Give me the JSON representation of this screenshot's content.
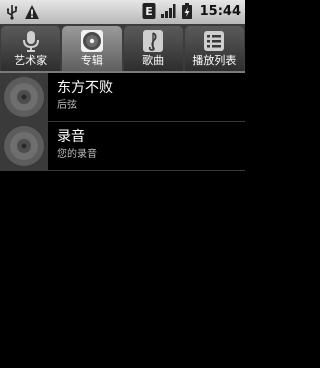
{
  "status_bar": {
    "time": "15:44",
    "icons": [
      "usb-icon",
      "warning-icon",
      "edge-data-icon",
      "signal-icon",
      "battery-icon"
    ]
  },
  "tabs": [
    {
      "label": "艺术家",
      "icon": "microphone-icon",
      "selected": false
    },
    {
      "label": "专辑",
      "icon": "album-disc-icon",
      "selected": true
    },
    {
      "label": "歌曲",
      "icon": "music-note-icon",
      "selected": false
    },
    {
      "label": "播放列表",
      "icon": "playlist-icon",
      "selected": false
    }
  ],
  "albums": [
    {
      "title": "东方不败",
      "subtitle": "后弦"
    },
    {
      "title": "录音",
      "subtitle": "您的录音"
    }
  ]
}
